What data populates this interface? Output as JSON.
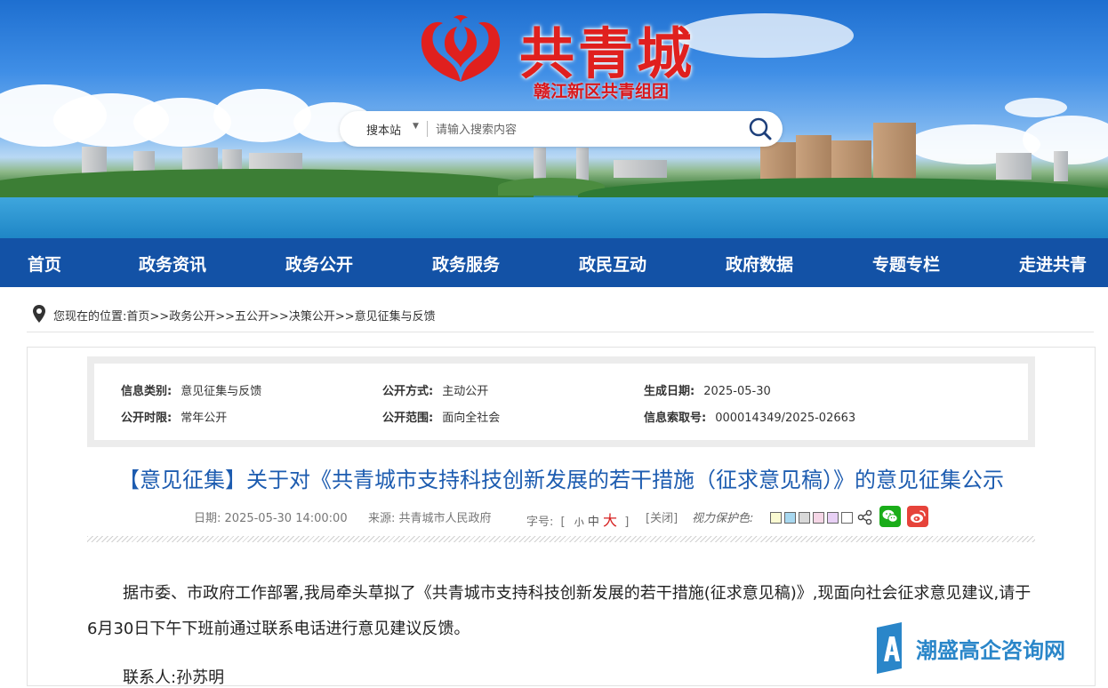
{
  "banner": {
    "logo_title": "共青城",
    "logo_subtitle": "赣江新区共青组团"
  },
  "search": {
    "scope": "搜本站",
    "placeholder": "请输入搜索内容"
  },
  "nav": {
    "items": [
      "首页",
      "政务资讯",
      "政务公开",
      "政务服务",
      "政民互动",
      "政府数据",
      "专题专栏",
      "走进共青"
    ]
  },
  "breadcrumb": {
    "prefix": "您现在的位置:",
    "items": [
      "首页",
      "政务公开",
      "五公开",
      "决策公开",
      "意见征集与反馈"
    ],
    "separator": ">>"
  },
  "info_table": {
    "category_label": "信息类别:",
    "category_value": "意见征集与反馈",
    "method_label": "公开方式:",
    "method_value": "主动公开",
    "date_label": "生成日期:",
    "date_value": "2025-05-30",
    "period_label": "公开时限:",
    "period_value": "常年公开",
    "scope_label": "公开范围:",
    "scope_value": "面向全社会",
    "index_label": "信息索取号:",
    "index_value": "000014349/2025-02663"
  },
  "article": {
    "title": "【意见征集】关于对《共青城市支持科技创新发展的若干措施（征求意见稿）》的意见征集公示",
    "date_label": "日期:",
    "date": "2025-05-30 14:00:00",
    "source_label": "来源:",
    "source": "共青城市人民政府",
    "font_size_label": "字号:",
    "bracket_open": "[",
    "bracket_close": "]",
    "font_small": "小",
    "font_medium": "中",
    "font_large": "大",
    "close_label": "[关闭]",
    "eye_care_label": "视力保护色:",
    "eye_care_colors": [
      "#fafad2",
      "#a8d8f0",
      "#d8d8d8",
      "#f5d6e6",
      "#e8d0f5",
      "#ffffff"
    ],
    "paragraph": "据市委、市政府工作部署,我局牵头草拟了《共青城市支持科技创新发展的若干措施(征求意见稿)》,现面向社会征求意见建议,请于6月30日下午下班前通过联系电话进行意见建议反馈。",
    "contact": "联系人:孙苏明"
  },
  "watermark": {
    "text": "潮盛高企咨询网"
  },
  "colors": {
    "nav_bg": "#1352a6",
    "title_blue": "#1d5cb0",
    "logo_red": "#e0201e",
    "wechat_green": "#1aad19",
    "weibo_red": "#e6433a"
  }
}
